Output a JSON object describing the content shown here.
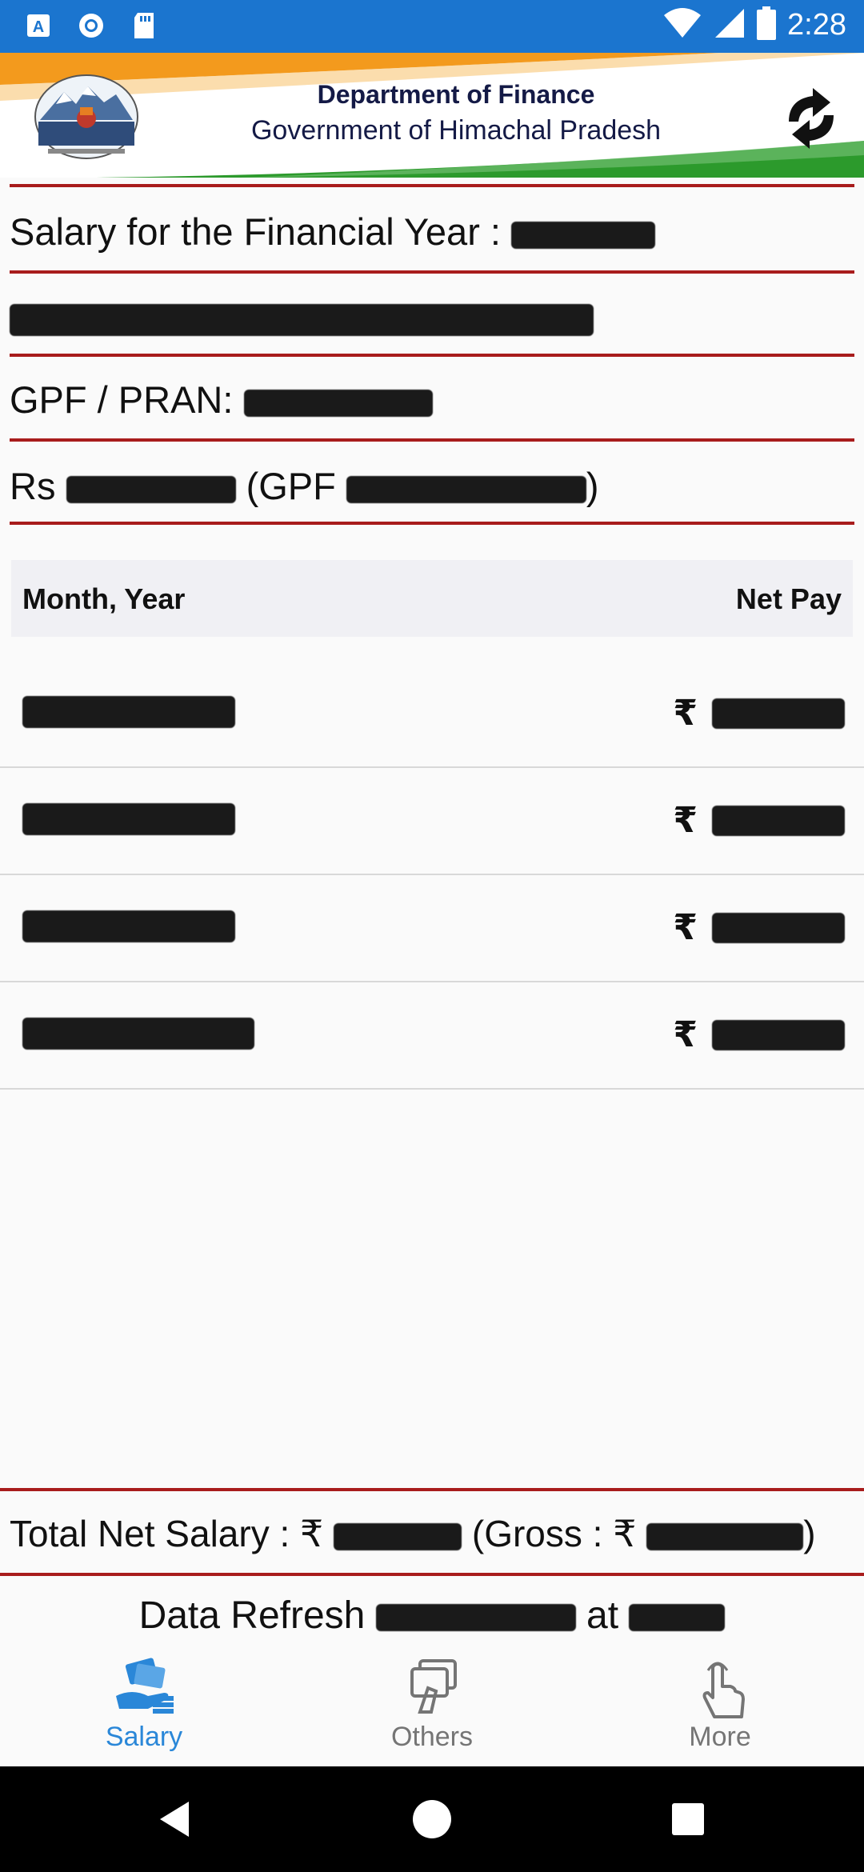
{
  "status_bar": {
    "time": "2:28",
    "icons": [
      "text-a-icon",
      "circle-notification-icon",
      "sd-card-icon",
      "wifi-icon",
      "signal-icon",
      "battery-icon"
    ]
  },
  "header": {
    "title": "Department of Finance",
    "subtitle": "Government of Himachal Pradesh",
    "icons": [
      "emblem-icon",
      "refresh-icon"
    ]
  },
  "info": {
    "financial_year_label": "Salary for the Financial Year :",
    "gpf_label": "GPF / PRAN:",
    "rs_label": "Rs",
    "gpf_open": "(GPF",
    "gpf_close": ")"
  },
  "table": {
    "col_month": "Month, Year",
    "col_net_pay": "Net Pay",
    "currency": "₹",
    "rows": 4
  },
  "footer": {
    "total_label": "Total Net Salary :",
    "currency": "₹",
    "gross_open": "(Gross :",
    "gross_close": ")",
    "refresh_label": "Data Refresh",
    "refresh_at": "at"
  },
  "bottom_nav": {
    "items": [
      {
        "label": "Salary",
        "icon": "salary-icon",
        "active": true
      },
      {
        "label": "Others",
        "icon": "cards-icon",
        "active": false
      },
      {
        "label": "More",
        "icon": "hand-pointer-icon",
        "active": false
      }
    ]
  },
  "colors": {
    "status_bar": "#1b75cf",
    "divider": "#a81c1c",
    "active_tab": "#2a87d8",
    "title_navy": "#141a46"
  }
}
